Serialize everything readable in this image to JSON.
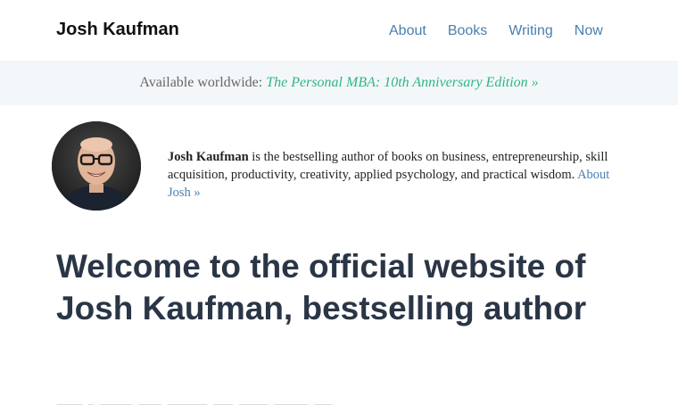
{
  "header": {
    "site_title": "Josh Kaufman",
    "nav": [
      {
        "label": "About"
      },
      {
        "label": "Books"
      },
      {
        "label": "Writing"
      },
      {
        "label": "Now"
      }
    ]
  },
  "banner": {
    "prefix": "Available worldwide:",
    "link_text": "The Personal MBA: 10th Anniversary Edition »"
  },
  "bio": {
    "name": "Josh Kaufman",
    "text": " is the bestselling author of books on business, entrepreneurship, skill acquisition, productivity, creativity, applied psychology, and practical wisdom. ",
    "link_text": "About Josh »"
  },
  "main": {
    "headline": "Welcome to the official website of Josh Kaufman, bestselling author"
  },
  "colors": {
    "link": "#4a7fb0",
    "banner_link": "#2fb586",
    "heading": "#2a3646",
    "banner_bg": "#f4f7f9"
  }
}
